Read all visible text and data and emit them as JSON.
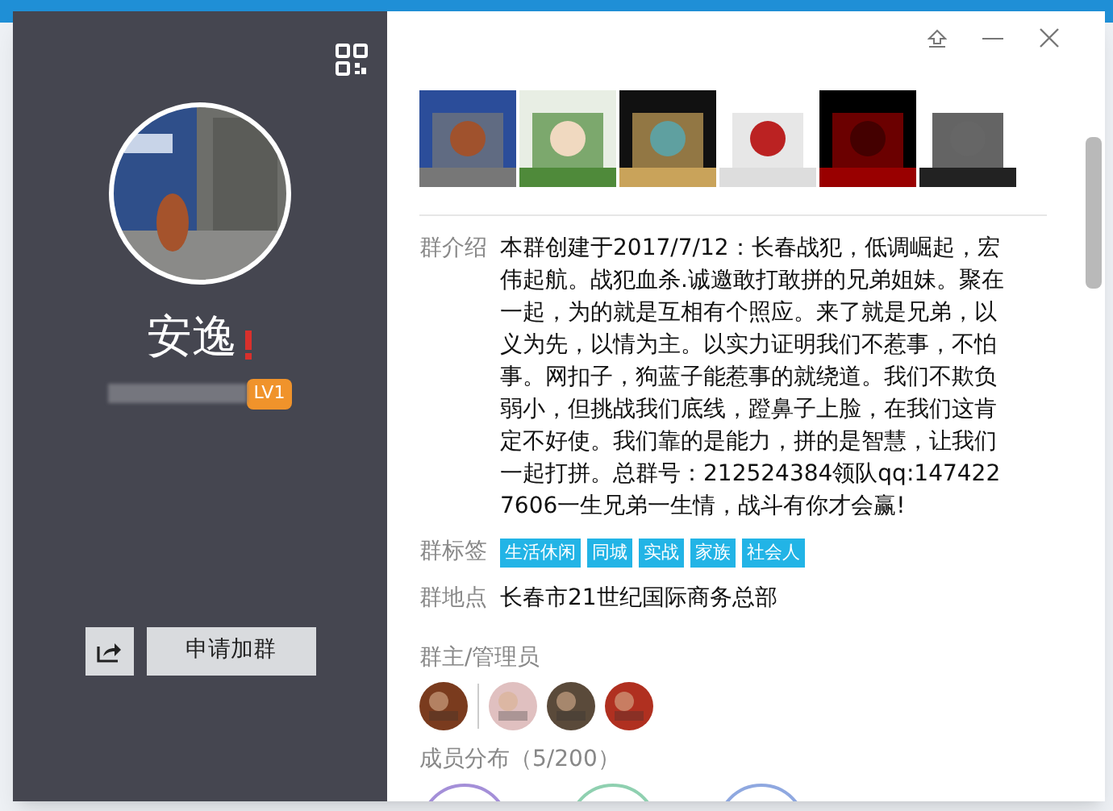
{
  "profile": {
    "name": "安逸",
    "level_badge": "LV1",
    "warning": true
  },
  "actions": {
    "join_button": "申请加群"
  },
  "info": [
    {
      "kind": "text",
      "label": "群介绍",
      "value": "本群创建于2017/7/12：长春战犯，低调崛起，宏伟起航。战犯血杀.诚邀敢打敢拼的兄弟姐妹。聚在一起，为的就是互相有个照应。来了就是兄弟，以义为先，以情为主。以实力证明我们不惹事，不怕事。网扣子，狗蓝子能惹事的就绕道。我们不欺负弱小，但挑战我们底线，蹬鼻子上脸，在我们这肯定不好使。我们靠的是能力，拼的是智慧，让我们一起打拼。总群号：212524384领队qq:1474227606一生兄弟一生情，战斗有你才会赢!"
    },
    {
      "kind": "tags",
      "label": "群标签",
      "tags": [
        "生活休闲",
        "同城",
        "实战",
        "家族",
        "社会人"
      ]
    },
    {
      "kind": "text",
      "label": "群地点",
      "value": "长春市21世纪国际商务总部"
    }
  ],
  "admins": {
    "title": "群主/管理员"
  },
  "members": {
    "title": "成员分布（5/200）"
  }
}
